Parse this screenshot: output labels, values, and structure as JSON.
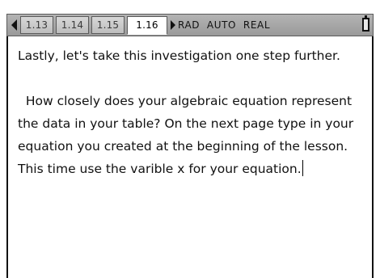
{
  "tabs": [
    {
      "label": "1.13",
      "active": false
    },
    {
      "label": "1.14",
      "active": false
    },
    {
      "label": "1.15",
      "active": false
    },
    {
      "label": "1.16",
      "active": true
    }
  ],
  "status": {
    "settings": "RAD  AUTO  REAL"
  },
  "icons": {
    "left_arrow": "left-triangle-icon",
    "right_arrow": "right-triangle-icon",
    "battery": "battery-icon"
  },
  "document": {
    "paragraph_1": "Lastly, let's take this investigation one step further.",
    "paragraph_2": "  How closely does your algebraic equation represent the data in your table? On the next page type in your equation you created at the beginning of the lesson. This time use the varible x for your equation."
  },
  "colors": {
    "bar": "#a8a8a8",
    "active_tab": "#ffffff",
    "text": "#111111"
  }
}
